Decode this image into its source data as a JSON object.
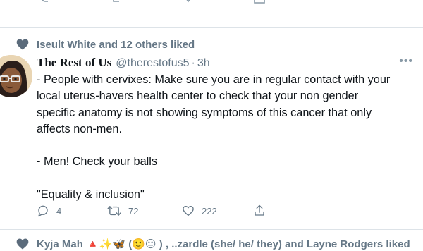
{
  "social_context": {
    "text": "Iseult White and 12 others liked",
    "icon": "heart-filled-icon"
  },
  "tweet": {
    "display_name": "The Rest of Us",
    "handle": "@therestofus5",
    "separator": "·",
    "time": "3h",
    "more": "•••",
    "lines": [
      "- People with cervixes: Make sure you are in regular contact with your",
      "local uterus-havers health center to check that your non gender",
      "specific anatomy is not showing symptoms of this cancer that only",
      "affects non-men.",
      "",
      "- Men! Check your balls",
      "",
      "\"Equality & inclusion\""
    ],
    "actions": {
      "reply_count": "4",
      "retweet_count": "72",
      "like_count": "222"
    }
  },
  "next_item": {
    "text": "Kyja Mah 🔺✨🦋 (🙂😐 ) , ..zardle (she/ he/ they) and Layne Rodgers liked"
  },
  "colors": {
    "secondary_text": "#657786",
    "icon_gray": "#8899a6",
    "divider": "#dde3e8"
  }
}
